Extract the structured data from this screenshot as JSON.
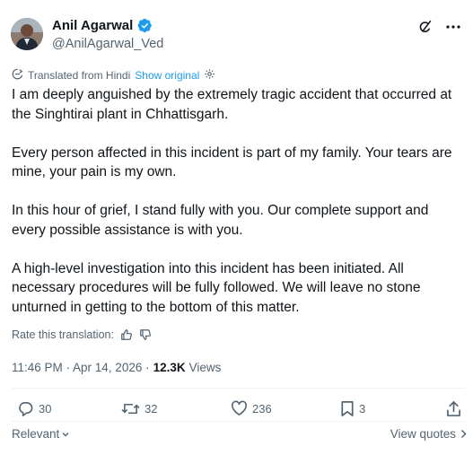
{
  "author": {
    "name": "Anil Agarwal",
    "handle": "@AnilAgarwal_Ved"
  },
  "translation": {
    "label": "Translated from Hindi",
    "show_original": "Show original"
  },
  "post": {
    "paragraphs": [
      "I am deeply anguished by the extremely tragic accident that occurred at the Singhtirai plant in Chhattisgarh.",
      "Every person affected in this incident is part of my family. Your tears are mine, your pain is my own.",
      "In this hour of grief, I stand fully with you. Our complete support and every possible assistance is with you.",
      "A high-level investigation into this incident has been initiated. All necessary procedures will be fully followed. We will leave no stone unturned in getting to the bottom of this matter."
    ],
    "rate_label": "Rate this translation:",
    "timestamp": "11:46 PM · Apr 14, 2026 ·",
    "views_count": "12.3K",
    "views_label": "Views"
  },
  "engagement": {
    "replies": "30",
    "reposts": "32",
    "likes": "236",
    "bookmarks": "3"
  },
  "footer": {
    "sort_label": "Relevant",
    "view_quotes": "View quotes"
  },
  "colors": {
    "accent": "#1d9bf0",
    "secondary_text": "#536471"
  }
}
